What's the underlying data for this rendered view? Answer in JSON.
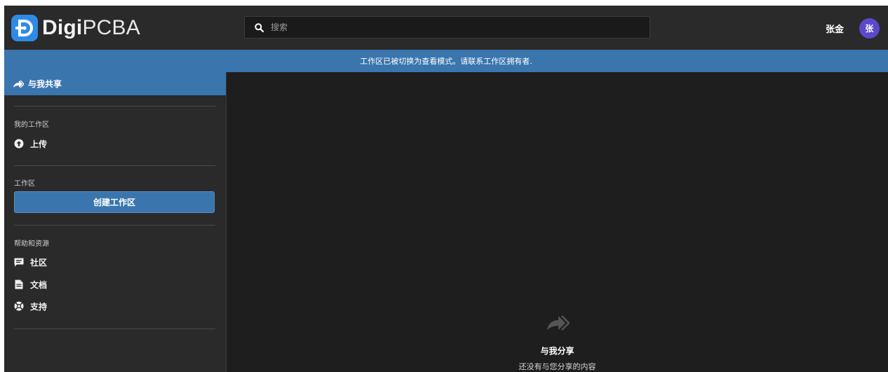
{
  "header": {
    "logo_bold": "Digi",
    "logo_rest": "PCBA",
    "search_placeholder": "搜索",
    "user_name": "张金",
    "avatar_initial": "张"
  },
  "banner": {
    "text": "工作区已被切换为查看模式。请联系工作区拥有者."
  },
  "sidebar": {
    "shared_label": "与我共享",
    "my_workspace": {
      "title": "我的工作区",
      "upload_label": "上传"
    },
    "workspaces": {
      "title": "工作区",
      "create_label": "创建工作区"
    },
    "help": {
      "title": "帮助和资源",
      "items": [
        {
          "label": "社区",
          "icon": "chat-icon"
        },
        {
          "label": "文档",
          "icon": "document-icon"
        },
        {
          "label": "支持",
          "icon": "lifebuoy-icon"
        }
      ]
    }
  },
  "main": {
    "empty_title": "与我分享",
    "empty_subtitle": "还没有与您分享的内容"
  },
  "colors": {
    "accent": "#3a75ad",
    "background": "#1e1e1e",
    "panel": "#2a2a2a",
    "avatar": "#5a49c9",
    "logo": "#2e8ae6"
  }
}
